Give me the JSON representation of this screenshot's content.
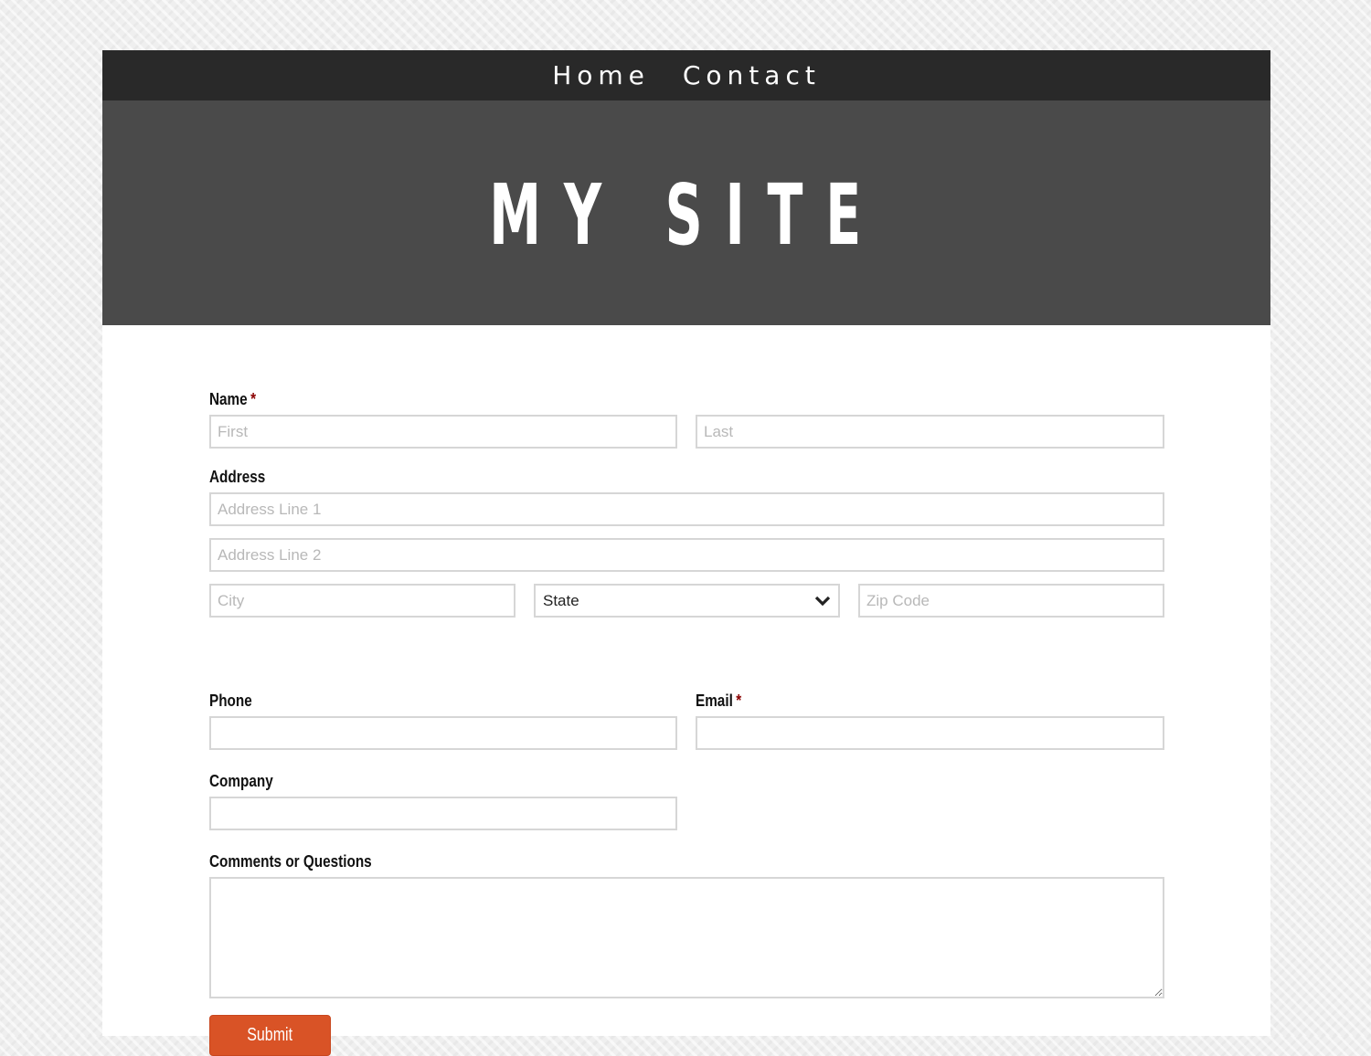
{
  "nav": {
    "items": [
      {
        "label": "Home"
      },
      {
        "label": "Contact"
      }
    ]
  },
  "banner": {
    "title": "MY SITE"
  },
  "form": {
    "required_marker": "*",
    "name": {
      "label": "Name",
      "first_placeholder": "First",
      "last_placeholder": "Last",
      "required": true
    },
    "address": {
      "label": "Address",
      "line1_placeholder": "Address Line 1",
      "line2_placeholder": "Address Line 2",
      "city_placeholder": "City",
      "state_selected": "State",
      "zip_placeholder": "Zip Code"
    },
    "phone": {
      "label": "Phone",
      "value": ""
    },
    "email": {
      "label": "Email",
      "value": "",
      "required": true
    },
    "company": {
      "label": "Company",
      "value": ""
    },
    "comments": {
      "label": "Comments or Questions",
      "value": ""
    },
    "submit_label": "Submit"
  },
  "colors": {
    "nav_bg": "#292929",
    "banner_bg": "#4a4a4a",
    "accent": "#d95326",
    "required": "#8b0000"
  }
}
